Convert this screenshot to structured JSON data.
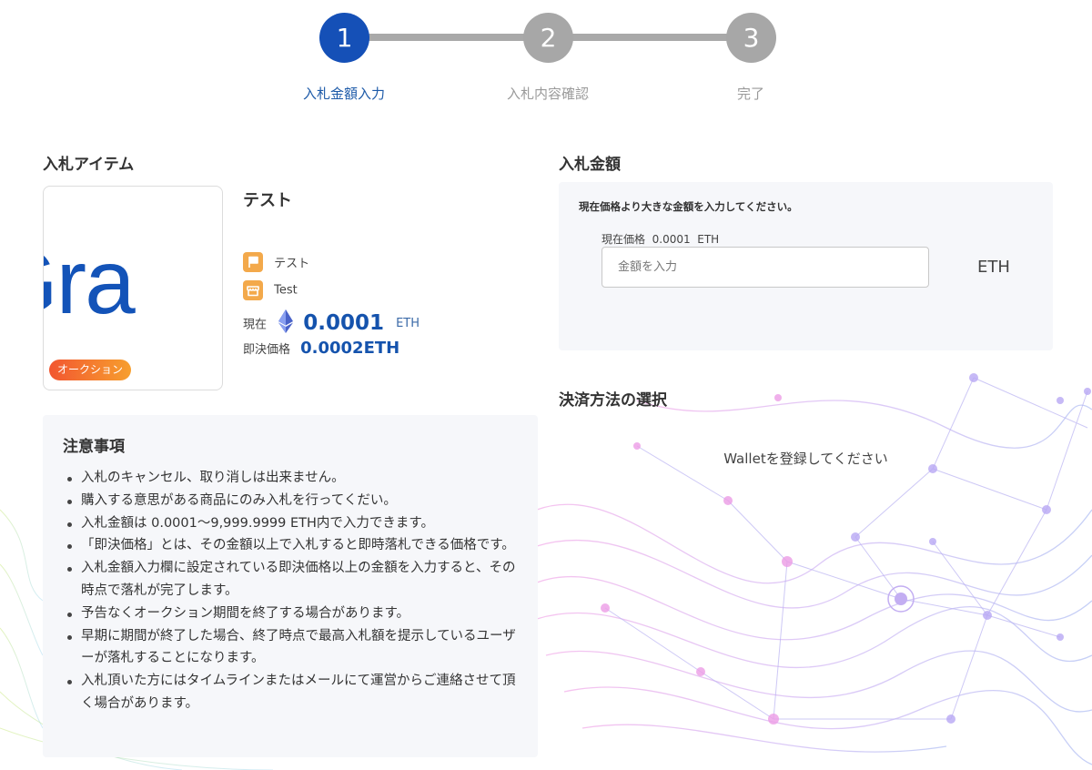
{
  "stepper": {
    "steps": [
      {
        "number": "1",
        "label": "入札金額入力",
        "active": true
      },
      {
        "number": "2",
        "label": "入札内容確認",
        "active": false
      },
      {
        "number": "3",
        "label": "完了",
        "active": false
      }
    ]
  },
  "item_section": {
    "title": "入札アイテム",
    "image_logo_text": "Gra",
    "badge": "オークション",
    "name": "テスト",
    "category": "テスト",
    "shop": "Test",
    "current_label": "現在",
    "current_price": "0.0001",
    "current_unit": "ETH",
    "buy_now_label": "即決価格",
    "buy_now_price": "0.0002ETH"
  },
  "notes": {
    "title": "注意事項",
    "items": [
      "入札のキャンセル、取り消しは出来ません。",
      "購入する意思がある商品にのみ入札を行ってくだい。",
      "入札金額は 0.0001〜9,999.9999 ETH内で入力できます。",
      "「即決価格」とは、その金額以上で入札すると即時落札できる価格です。",
      "入札金額入力欄に設定されている即決価格以上の金額を入力すると、その時点で落札が完了します。",
      "予告なくオークション期間を終了する場合があります。",
      "早期に期間が終了した場合、終了時点で最高入札額を提示しているユーザーが落札することになります。",
      "入札頂いた方にはタイムラインまたはメールにて運営からご連絡させて頂く場合があります。"
    ]
  },
  "bid": {
    "title": "入札金額",
    "hint": "現在価格より大きな金額を入力してください。",
    "current_price_text": "現在価格  0.0001  ETH",
    "input_value": "",
    "input_placeholder": "金額を入力",
    "unit": "ETH"
  },
  "payment": {
    "title": "決済方法の選択",
    "message": "Walletを登録してください"
  },
  "colors": {
    "accent": "#1550b7",
    "price": "#1553ad",
    "step_inactive": "#a7a7a7",
    "icon_orange": "#f3a94b",
    "panel_bg": "#f6f7fa"
  }
}
